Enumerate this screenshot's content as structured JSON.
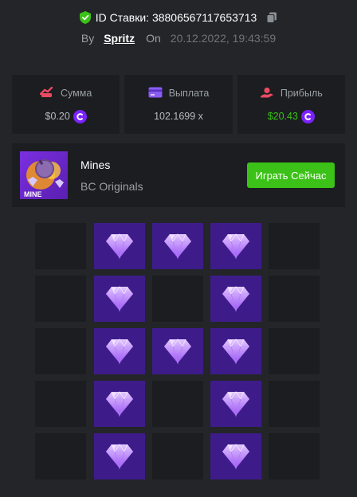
{
  "header": {
    "bet_id_label": "ID Ставки: 38806567117653713",
    "by_label": "By",
    "username": "Spritz",
    "on_label": "On",
    "datetime": "20.12.2022, 19:43:59"
  },
  "stats": [
    {
      "label": "Сумма",
      "value": "$0.20",
      "icon": "money-icon",
      "coin": true
    },
    {
      "label": "Выплата",
      "value": "102.1699 x",
      "icon": "card-icon",
      "coin": false
    },
    {
      "label": "Прибыль",
      "value": "$20.43",
      "icon": "profit-icon",
      "coin": true
    }
  ],
  "game": {
    "thumb_text": "MINE",
    "name": "Mines",
    "provider": "BC Originals",
    "play_label": "Играть Сейчас"
  },
  "board": {
    "rows": [
      [
        "empty",
        "gem",
        "gem",
        "gem",
        "empty"
      ],
      [
        "empty",
        "gem",
        "empty",
        "gem",
        "empty"
      ],
      [
        "empty",
        "gem",
        "gem",
        "gem",
        "empty"
      ],
      [
        "empty",
        "gem",
        "empty",
        "gem",
        "empty"
      ],
      [
        "empty",
        "gem",
        "empty",
        "gem",
        "empty"
      ]
    ]
  },
  "colors": {
    "accent_green": "#3bc117",
    "coin_purple": "#7b22ff",
    "gem_cell": "#3d1c8a",
    "card_bg": "#1b1d20"
  }
}
